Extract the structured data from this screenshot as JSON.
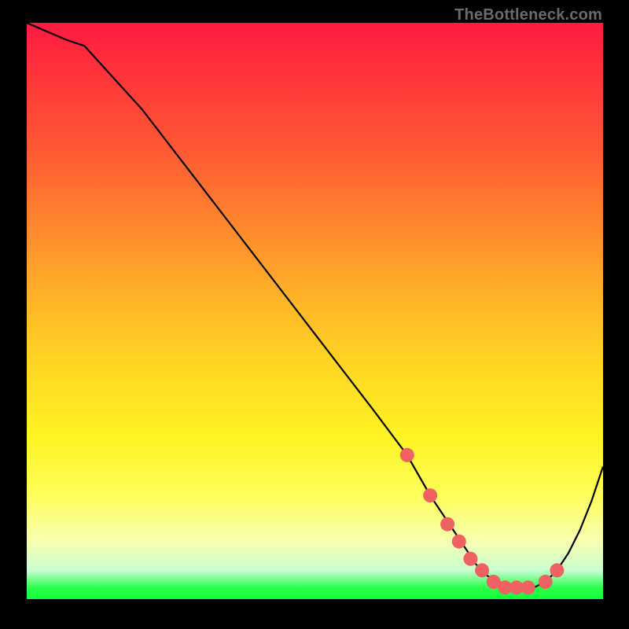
{
  "branding": "TheBottleneck.com",
  "chart_data": {
    "type": "line",
    "title": "",
    "xlabel": "",
    "ylabel": "",
    "xlim": [
      0,
      100
    ],
    "ylim": [
      0,
      100
    ],
    "series": [
      {
        "name": "bottleneck-curve",
        "x": [
          0,
          7,
          10,
          20,
          30,
          40,
          50,
          60,
          66,
          70,
          74,
          76,
          78,
          80,
          82,
          84,
          86,
          88,
          90,
          92,
          94,
          96,
          98,
          100
        ],
        "values": [
          100,
          97,
          96,
          85,
          72,
          59,
          46,
          33,
          25,
          18,
          12,
          9,
          6,
          4,
          3,
          2,
          2,
          2,
          3,
          5,
          8,
          12,
          17,
          23
        ]
      }
    ],
    "markers": {
      "name": "highlight-dots",
      "x": [
        66,
        70,
        73,
        75,
        77,
        79,
        81,
        83,
        85,
        87,
        90,
        92
      ],
      "values": [
        25,
        18,
        13,
        10,
        7,
        5,
        3,
        2,
        2,
        2,
        3,
        5
      ],
      "color": "#f06262",
      "size": 9
    },
    "colors": {
      "curve": "#000000",
      "background_top": "#ff1a41",
      "background_bottom": "#0fff39"
    }
  }
}
